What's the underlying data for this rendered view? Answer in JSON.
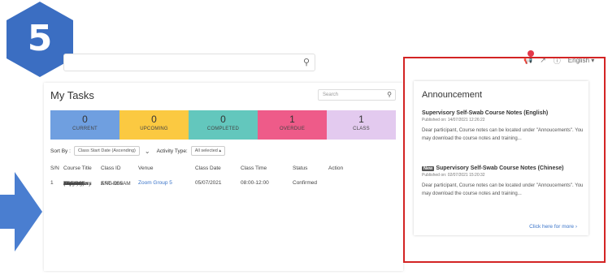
{
  "step": "5",
  "top_search": {
    "icon": "search-icon"
  },
  "header": {
    "language": "English ▾",
    "icons": [
      "megaphone-icon",
      "external-link-icon",
      "help-icon"
    ]
  },
  "tasks": {
    "title": "My Tasks",
    "search_placeholder": "Search",
    "stats": [
      {
        "count": "0",
        "label": "CURRENT",
        "color": "#6f9fe0"
      },
      {
        "count": "0",
        "label": "UPCOMING",
        "color": "#fbc941"
      },
      {
        "count": "0",
        "label": "COMPLETED",
        "color": "#63c7bd"
      },
      {
        "count": "1",
        "label": "OVERDUE",
        "color": "#ee5b89"
      },
      {
        "count": "1",
        "label": "CLASS",
        "color": "#e3caef"
      }
    ],
    "sort_by_label": "Sort By :",
    "sort_by_value": "Class Start Date (Ascending)",
    "activity_type_label": "Activity Type:",
    "activity_type_value": "All selected ▴",
    "columns": [
      "S/N",
      "Course Title",
      "Class ID",
      "Venue",
      "Class Date",
      "Class Time",
      "Status",
      "Action"
    ],
    "row": {
      "sn": "1",
      "course_title_lines": [
        "(English)",
        "Online",
        "Zoom Class",
        "(8am to",
        "12pm):",
        "Supervisory",
        "Training in",
        "ART Self-",
        "Swab"
      ],
      "class_id_lines": [
        "ART-SS#AM",
        "ENG-005"
      ],
      "venue": "Zoom Group 5",
      "class_date": "05/07/2021",
      "class_time": "08:00-12:00",
      "status": "Confirmed",
      "action": ""
    }
  },
  "announcement": {
    "title": "Announcement",
    "items": [
      {
        "badge": "",
        "heading": "Supervisory Self-Swab Course Notes (English)",
        "published": "Published on: 14/07/2021 12:26:22",
        "body": "Dear participant, Course notes can be located under \"Annoucements\". You may download the course notes and training..."
      },
      {
        "badge": "New",
        "heading": "Supervisory Self-Swab Course Notes (Chinese)",
        "published": "Published on: 02/07/2021 15:20:32",
        "body": "Dear participant, Course notes can be located under \"Annoucements\". You may download the course notes and training..."
      }
    ],
    "more_link": "Click here for more ›"
  },
  "colors": {
    "badge_blue": "#3b6ec2",
    "arrow_blue": "#4a7ed0",
    "highlight_red": "#d32424"
  }
}
